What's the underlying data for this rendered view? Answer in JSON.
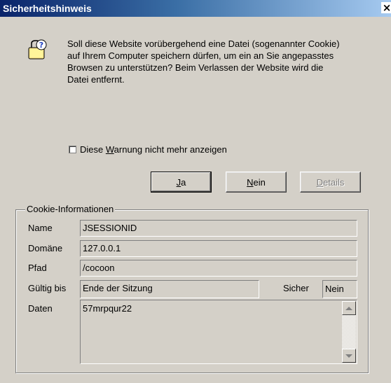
{
  "window": {
    "title": "Sicherheitshinweis",
    "close_glyph": "×"
  },
  "message": {
    "lines": [
      "Soll diese Website vorübergehend eine Datei (sogenannter Cookie)",
      "auf Ihrem Computer speichern dürfen, um ein an Sie angepasstes",
      "Browsen zu unterstützen? Beim Verlassen der Website wird die",
      "Datei entfernt."
    ],
    "icon": "cookie-warning-icon"
  },
  "checkbox": {
    "label_pre": "Diese ",
    "label_mnemonic": "W",
    "label_post": "arnung nicht mehr anzeigen",
    "checked": false
  },
  "buttons": {
    "yes_mnemonic": "J",
    "yes_rest": "a",
    "no_mnemonic": "N",
    "no_rest": "ein",
    "details_mnemonic": "D",
    "details_rest": "etails"
  },
  "cookie_info": {
    "group_title": "Cookie-Informationen",
    "name_label": "Name",
    "name_value": "JSESSIONID",
    "domain_label": "Domäne",
    "domain_value": "127.0.0.1",
    "path_label": "Pfad",
    "path_value": "/cocoon",
    "valid_label": "Gültig bis",
    "valid_value": "Ende der Sitzung",
    "secure_label": "Sicher",
    "secure_value": "Nein",
    "data_label": "Daten",
    "data_value": "57mrpqur22"
  }
}
